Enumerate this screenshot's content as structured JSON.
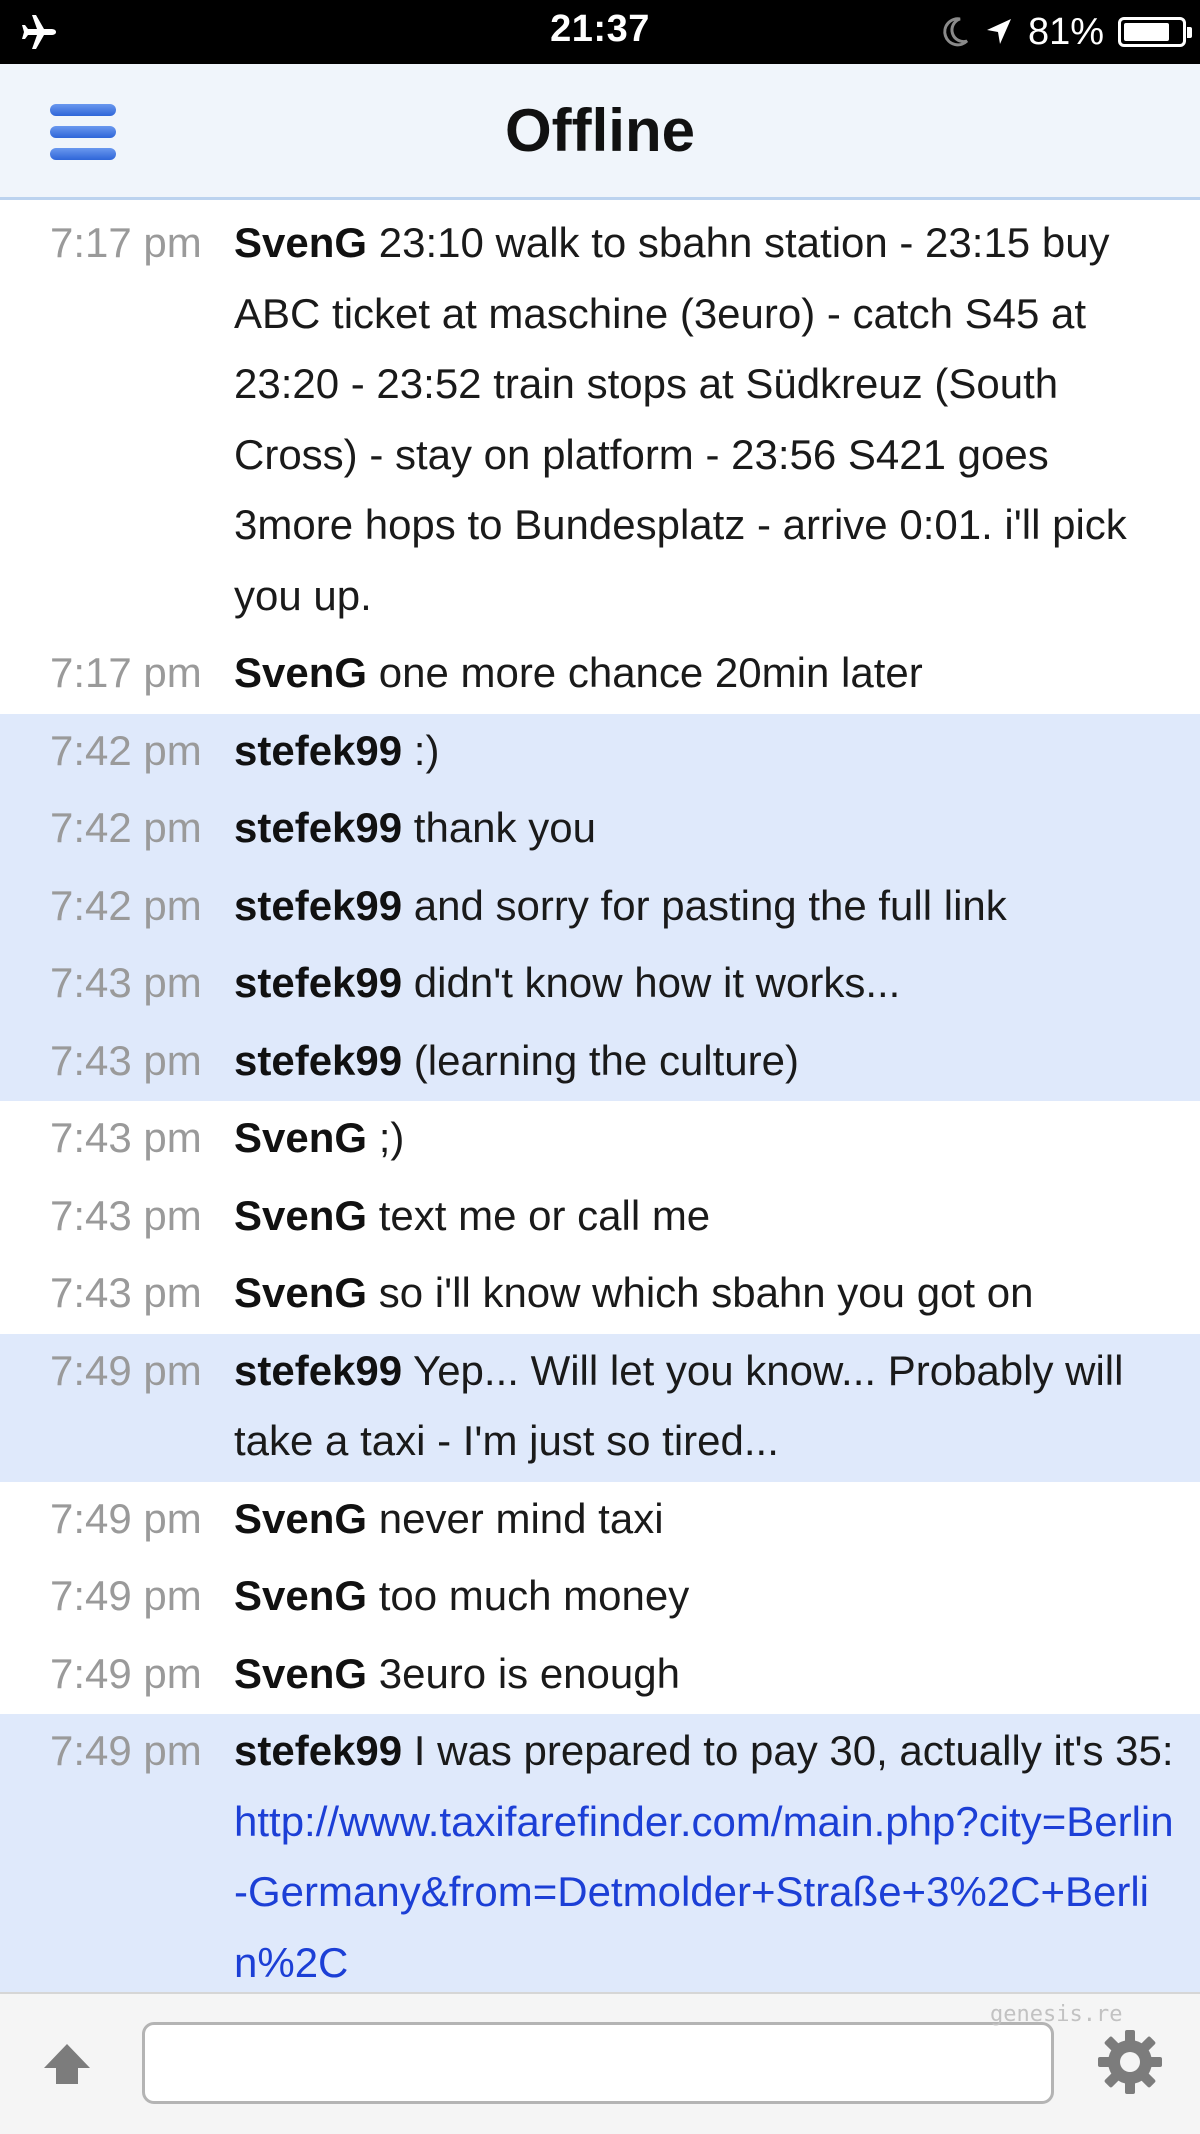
{
  "status_bar": {
    "time": "21:37",
    "battery_percent": "81%",
    "battery_level": 0.81,
    "icons": [
      "airplane-icon",
      "moon-icon",
      "location-arrow-icon",
      "battery-icon"
    ]
  },
  "nav": {
    "title": "Offline",
    "menu_icon": "hamburger-menu-icon"
  },
  "messages": [
    {
      "time": "7:17 pm",
      "sender": "SvenG",
      "text": " 23:10 walk to sbahn station - 23:15 buy ABC ticket at maschine (3euro) - catch S45 at 23:20 - 23:52 train stops at Südkreuz (South Cross) - stay on platform - 23:56 S421 goes 3more hops to Bundesplatz - arrive 0:01.  i'll pick you up.",
      "highlight": false
    },
    {
      "time": "7:17 pm",
      "sender": "SvenG",
      "text": " one more chance 20min later",
      "highlight": false
    },
    {
      "time": "7:42 pm",
      "sender": "stefek99",
      "text": " :)",
      "highlight": true
    },
    {
      "time": "7:42 pm",
      "sender": "stefek99",
      "text": " thank you",
      "highlight": true
    },
    {
      "time": "7:42 pm",
      "sender": "stefek99",
      "text": " and sorry for pasting the full link",
      "highlight": true
    },
    {
      "time": "7:43 pm",
      "sender": "stefek99",
      "text": " didn't know how it works...",
      "highlight": true
    },
    {
      "time": "7:43 pm",
      "sender": "stefek99",
      "text": " (learning the culture)",
      "highlight": true
    },
    {
      "time": "7:43 pm",
      "sender": "SvenG",
      "text": " ;)",
      "highlight": false
    },
    {
      "time": "7:43 pm",
      "sender": "SvenG",
      "text": " text me or call me",
      "highlight": false
    },
    {
      "time": "7:43 pm",
      "sender": "SvenG",
      "text": " so i'll know which sbahn you got on",
      "highlight": false
    },
    {
      "time": "7:49 pm",
      "sender": "stefek99",
      "text": " Yep... Will let you know... Probably will take a taxi - I'm just so tired...",
      "highlight": true
    },
    {
      "time": "7:49 pm",
      "sender": "SvenG",
      "text": " never mind taxi",
      "highlight": false
    },
    {
      "time": "7:49 pm",
      "sender": "SvenG",
      "text": " too much money",
      "highlight": false
    },
    {
      "time": "7:49 pm",
      "sender": "SvenG",
      "text": " 3euro is enough",
      "highlight": false
    },
    {
      "time": "7:49 pm",
      "sender": "stefek99",
      "text": " I was prepared to pay 30, actually it's 35: ",
      "link": "http://www.taxifarefinder.com/main.php?city=Berlin-Germany&from=Detmolder+Straße+3%2C+Berlin%2C",
      "highlight": true
    }
  ],
  "input": {
    "value": "",
    "placeholder": ""
  },
  "bottom_bar": {
    "watermark": "genesis.re",
    "left_icon": "up-arrow-icon",
    "right_icon": "gear-icon"
  },
  "colors": {
    "status_bar_bg": "#000000",
    "nav_bg": "#f0f5fb",
    "nav_border": "#bcd3ef",
    "menu_icon": "#3b6fe0",
    "highlight_row": "#dfe9fb",
    "timestamp": "#9a9a9a",
    "link": "#1c3fd6"
  }
}
